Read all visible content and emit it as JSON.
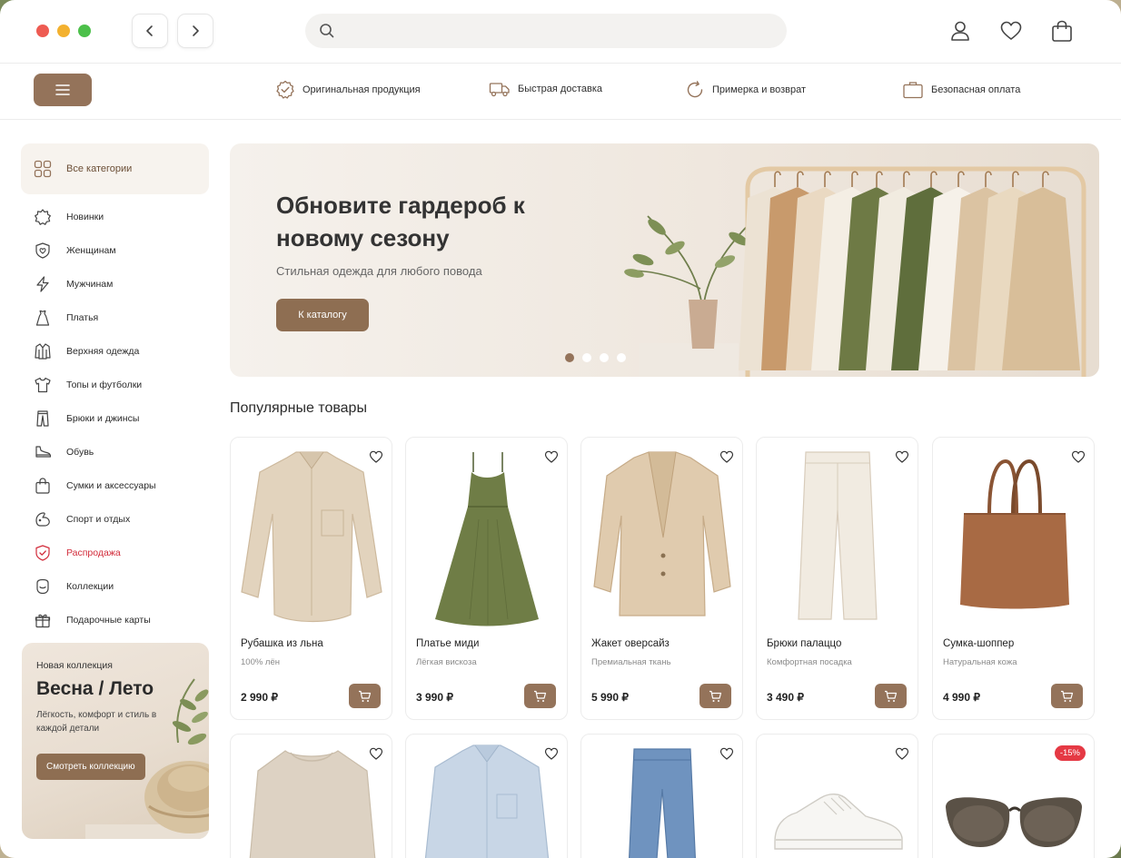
{
  "search": {
    "placeholder": ""
  },
  "features": [
    {
      "icon": "badge-check-icon",
      "label": "Оригинальная продукция"
    },
    {
      "icon": "truck-icon",
      "label": "Быстрая доставка"
    },
    {
      "icon": "refresh-icon",
      "label": "Примерка и возврат"
    },
    {
      "icon": "briefcase-icon",
      "label": "Безопасная оплата"
    }
  ],
  "sidebar": {
    "all_label": "Все категории",
    "items": [
      {
        "icon": "burst-icon",
        "label": "Новинки"
      },
      {
        "icon": "shield-heart-icon",
        "label": "Женщинам"
      },
      {
        "icon": "bolt-icon",
        "label": "Мужчинам"
      },
      {
        "icon": "dress-icon",
        "label": "Платья"
      },
      {
        "icon": "jacket-icon",
        "label": "Верхняя одежда"
      },
      {
        "icon": "tshirt-icon",
        "label": "Топы и футболки"
      },
      {
        "icon": "pants-icon",
        "label": "Брюки и джинсы"
      },
      {
        "icon": "shoe-icon",
        "label": "Обувь"
      },
      {
        "icon": "shopping-bag-icon",
        "label": "Сумки и аксессуары"
      },
      {
        "icon": "sport-icon",
        "label": "Спорт и отдых"
      },
      {
        "icon": "sale-shield-icon",
        "label": "Распродажа"
      },
      {
        "icon": "collection-icon",
        "label": "Коллекции"
      },
      {
        "icon": "gift-icon",
        "label": "Подарочные карты"
      }
    ]
  },
  "promo": {
    "kicker": "Новая коллекция",
    "title": "Весна / Лето",
    "text": "Лёгкость, комфорт и стиль в каждой детали",
    "button": "Смотреть коллекцию"
  },
  "hero": {
    "title": "Обновите гардероб к новому сезону",
    "subtitle": "Стильная одежда для любого повода",
    "button": "К каталогу",
    "slides_total": 4,
    "active_slide": 1
  },
  "products_title": "Популярные товары",
  "products": [
    {
      "name": "Рубашка из льна",
      "desc": "100% лён",
      "price": "2 990 ₽",
      "art": "shirt"
    },
    {
      "name": "Платье миди",
      "desc": "Лёгкая вискоза",
      "price": "3 990 ₽",
      "art": "dress"
    },
    {
      "name": "Жакет оверсайз",
      "desc": "Премиальная ткань",
      "price": "5 990 ₽",
      "art": "blazer"
    },
    {
      "name": "Брюки палаццо",
      "desc": "Комфортная посадка",
      "price": "3 490 ₽",
      "art": "trousers"
    },
    {
      "name": "Сумка-шоппер",
      "desc": "Натуральная кожа",
      "price": "4 990 ₽",
      "art": "tote"
    }
  ],
  "products_row2": [
    {
      "art": "sweater",
      "badge": ""
    },
    {
      "art": "blue-shirt",
      "badge": ""
    },
    {
      "art": "jeans",
      "badge": ""
    },
    {
      "art": "sneaker",
      "badge": ""
    },
    {
      "art": "sunglasses",
      "badge": "-15%"
    }
  ],
  "colors": {
    "accent": "#94735a",
    "sale": "#d22c3b",
    "badge": "#e53944"
  }
}
